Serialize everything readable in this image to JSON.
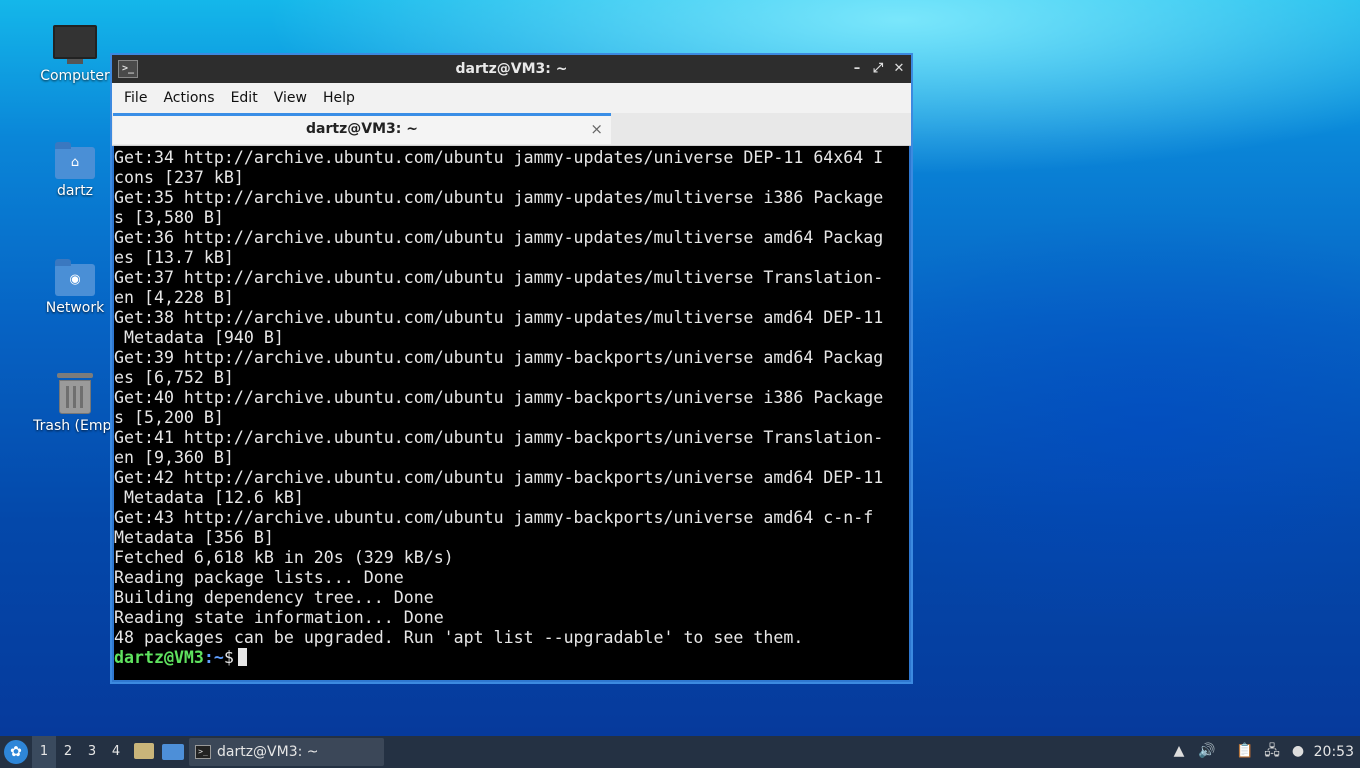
{
  "desktop": {
    "icons": [
      {
        "label": "Computer"
      },
      {
        "label": "dartz"
      },
      {
        "label": "Network"
      },
      {
        "label": "Trash (Empt"
      }
    ]
  },
  "window": {
    "title": "dartz@VM3: ~",
    "menu": [
      "File",
      "Actions",
      "Edit",
      "View",
      "Help"
    ],
    "tab_label": "dartz@VM3: ~",
    "tab_close": "×",
    "terminal_lines": [
      "Get:34 http://archive.ubuntu.com/ubuntu jammy-updates/universe DEP-11 64x64 I",
      "cons [237 kB]",
      "Get:35 http://archive.ubuntu.com/ubuntu jammy-updates/multiverse i386 Package",
      "s [3,580 B]",
      "Get:36 http://archive.ubuntu.com/ubuntu jammy-updates/multiverse amd64 Packag",
      "es [13.7 kB]",
      "Get:37 http://archive.ubuntu.com/ubuntu jammy-updates/multiverse Translation-",
      "en [4,228 B]",
      "Get:38 http://archive.ubuntu.com/ubuntu jammy-updates/multiverse amd64 DEP-11",
      " Metadata [940 B]",
      "Get:39 http://archive.ubuntu.com/ubuntu jammy-backports/universe amd64 Packag",
      "es [6,752 B]",
      "Get:40 http://archive.ubuntu.com/ubuntu jammy-backports/universe i386 Package",
      "s [5,200 B]",
      "Get:41 http://archive.ubuntu.com/ubuntu jammy-backports/universe Translation-",
      "en [9,360 B]",
      "Get:42 http://archive.ubuntu.com/ubuntu jammy-backports/universe amd64 DEP-11",
      " Metadata [12.6 kB]",
      "Get:43 http://archive.ubuntu.com/ubuntu jammy-backports/universe amd64 c-n-f",
      "Metadata [356 B]",
      "Fetched 6,618 kB in 20s (329 kB/s)",
      "Reading package lists... Done",
      "Building dependency tree... Done",
      "Reading state information... Done",
      "48 packages can be upgraded. Run 'apt list --upgradable' to see them."
    ],
    "prompt": {
      "user_host": "dartz@VM3",
      "path": ":~",
      "symbol": "$"
    }
  },
  "taskbar": {
    "workspaces": [
      "1",
      "2",
      "3",
      "4"
    ],
    "active_workspace": "1",
    "app_label": "dartz@VM3: ~",
    "clock": "20:53"
  }
}
